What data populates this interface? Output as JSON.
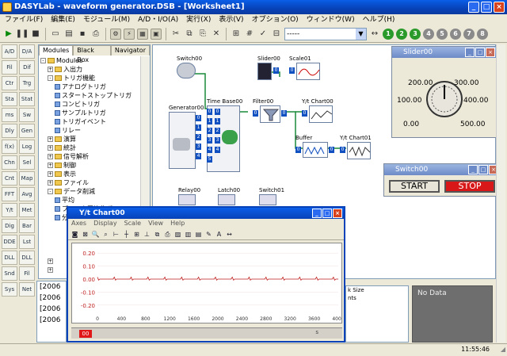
{
  "app": {
    "title": "DASYLab - waveform generator.DSB - [Worksheet1]"
  },
  "menu": [
    "ファイル(F)",
    "編集(E)",
    "モジュール(M)",
    "A/D・I/O(A)",
    "実行(X)",
    "表示(V)",
    "オプション(O)",
    "ウィンドウ(W)",
    "ヘルプ(H)"
  ],
  "toolbar": {
    "combo_value": "-----",
    "num_buttons": [
      "1",
      "2",
      "3",
      "4",
      "5",
      "6",
      "7",
      "8"
    ]
  },
  "lefttools": [
    "A/D",
    "D/A",
    "Fil",
    "Dif",
    "Ctr",
    "Trg",
    "Sta",
    "Stat",
    "ms",
    "Sw",
    "Dly",
    "Gen",
    "f(x)",
    "Log",
    "Chn",
    "Sel",
    "Cnt",
    "Map",
    "FFT",
    "Avg",
    "Y/t",
    "Met",
    "Dig",
    "Bar",
    "DDE",
    "Lst",
    "DLL",
    "DLL",
    "Snd",
    "Fil",
    "Sys",
    "Net"
  ],
  "library": {
    "tabs": [
      "Modules",
      "Black Box",
      "Navigator"
    ],
    "tree": [
      {
        "label": "Modules",
        "kind": "folder",
        "indent": 0,
        "box": "-"
      },
      {
        "label": "入出力",
        "kind": "folder",
        "indent": 1,
        "box": "+"
      },
      {
        "label": "トリガ機能",
        "kind": "folder",
        "indent": 1,
        "box": "-"
      },
      {
        "label": "アナログトリガ",
        "kind": "leaf",
        "indent": 2,
        "box": ""
      },
      {
        "label": "スタートストップトリガ",
        "kind": "leaf",
        "indent": 2,
        "box": ""
      },
      {
        "label": "コンビトリガ",
        "kind": "leaf",
        "indent": 2,
        "box": ""
      },
      {
        "label": "サンプルトリガ",
        "kind": "leaf",
        "indent": 2,
        "box": ""
      },
      {
        "label": "トリガイベント",
        "kind": "leaf",
        "indent": 2,
        "box": ""
      },
      {
        "label": "リレー",
        "kind": "leaf",
        "indent": 2,
        "box": ""
      },
      {
        "label": "演算",
        "kind": "folder",
        "indent": 1,
        "box": "+"
      },
      {
        "label": "統計",
        "kind": "folder",
        "indent": 1,
        "box": "+"
      },
      {
        "label": "信号解析",
        "kind": "folder",
        "indent": 1,
        "box": "+"
      },
      {
        "label": "制御",
        "kind": "folder",
        "indent": 1,
        "box": "+"
      },
      {
        "label": "表示",
        "kind": "folder",
        "indent": 1,
        "box": "+"
      },
      {
        "label": "ファイル",
        "kind": "folder",
        "indent": 1,
        "box": "+"
      },
      {
        "label": "データ削減",
        "kind": "folder",
        "indent": 1,
        "box": "-"
      },
      {
        "label": "平均",
        "kind": "leaf",
        "indent": 2,
        "box": ""
      },
      {
        "label": "ブロック平均化ポイント",
        "kind": "leaf",
        "indent": 2,
        "box": ""
      },
      {
        "label": "分割",
        "kind": "leaf",
        "indent": 2,
        "box": ""
      },
      {
        "label": "",
        "kind": "blank",
        "indent": 0,
        "box": ""
      },
      {
        "label": "",
        "kind": "blank",
        "indent": 0,
        "box": ""
      },
      {
        "label": "",
        "kind": "blank",
        "indent": 0,
        "box": ""
      },
      {
        "label": "",
        "kind": "blank",
        "indent": 0,
        "box": ""
      },
      {
        "label": "",
        "kind": "blank",
        "indent": 1,
        "box": "+"
      },
      {
        "label": "",
        "kind": "blank",
        "indent": 1,
        "box": "+"
      }
    ]
  },
  "worksheet": {
    "modules": {
      "switch": "Switch00",
      "slider": "Slider00",
      "scale": "Scale01",
      "generator": "Generator00",
      "time_base": "Time Base00",
      "filter": "Filter00",
      "yt_chart": "Y/t Chart00",
      "buffer": "Buffer",
      "yt_chart2": "Y/t Chart01",
      "relay": "Relay00",
      "latch": "Latch00",
      "switch2": "Switch01"
    }
  },
  "chart_window": {
    "title": "Y/t Chart00",
    "menu": [
      "Axes",
      "Display",
      "Scale",
      "View",
      "Help"
    ],
    "status_right": "s"
  },
  "chart_data": {
    "type": "line",
    "x": [
      0,
      200,
      400,
      600,
      800,
      1000,
      1200,
      1400,
      1600,
      1800,
      2000,
      2200,
      2400,
      2600,
      2800,
      3000,
      3200,
      3400,
      3600,
      3800,
      4000
    ],
    "xticks": [
      "0",
      "200",
      "400",
      "600",
      "800",
      "1000",
      "1200",
      "1400",
      "1600",
      "1800",
      "2000",
      "2200",
      "2400",
      "2600",
      "2800",
      "3000",
      "3200",
      "3400",
      "3600",
      "3800",
      "4000"
    ],
    "yticks": [
      "0.20",
      "0.10",
      "0.00",
      "-0.10",
      "-0.20"
    ],
    "ylim": [
      -0.25,
      0.25
    ],
    "xlim": [
      0,
      4000
    ],
    "series": [
      {
        "color": "#c02020",
        "values": [
          0,
          0,
          0.01,
          0,
          0,
          0.01,
          0,
          0,
          0.01,
          0,
          0,
          0.01,
          0,
          0,
          0.01,
          0,
          0,
          0.01,
          0,
          0,
          0
        ]
      }
    ]
  },
  "slider_window": {
    "title": "Slider00",
    "labels": [
      "200.00",
      "300.00",
      "100.00",
      "400.00",
      "0.00",
      "500.00"
    ],
    "value": 250
  },
  "switch_window": {
    "title": "Switch00",
    "start": "START",
    "stop": "STOP"
  },
  "log": [
    "[2006",
    "[2006",
    "[2006",
    "[2006"
  ],
  "props": [
    "",
    "",
    "",
    "",
    "k Size",
    "nts"
  ],
  "nodata": "No Data",
  "status": {
    "time": "11:55:46"
  }
}
